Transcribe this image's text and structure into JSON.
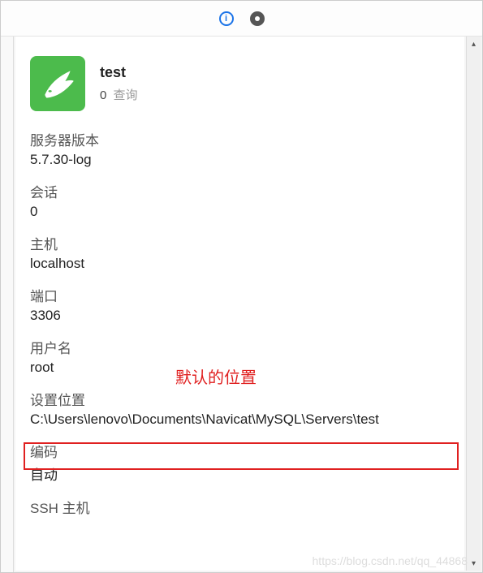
{
  "toolbar": {
    "info_icon": "info-icon",
    "view_icon": "view-icon"
  },
  "connection": {
    "name": "test",
    "query_count": "0",
    "query_label": "查询"
  },
  "fields": {
    "server_version": {
      "label": "服务器版本",
      "value": "5.7.30-log"
    },
    "sessions": {
      "label": "会话",
      "value": "0"
    },
    "host": {
      "label": "主机",
      "value": "localhost"
    },
    "port": {
      "label": "端口",
      "value": "3306"
    },
    "username": {
      "label": "用户名",
      "value": "root"
    },
    "settings_path": {
      "label": "设置位置",
      "value": "C:\\Users\\lenovo\\Documents\\Navicat\\MySQL\\Servers\\test"
    },
    "encoding": {
      "label": "编码",
      "value": "自动"
    },
    "ssh_host": {
      "label": "SSH 主机",
      "value": ""
    }
  },
  "annotation": "默认的位置",
  "watermark": "https://blog.csdn.net/qq_44868"
}
